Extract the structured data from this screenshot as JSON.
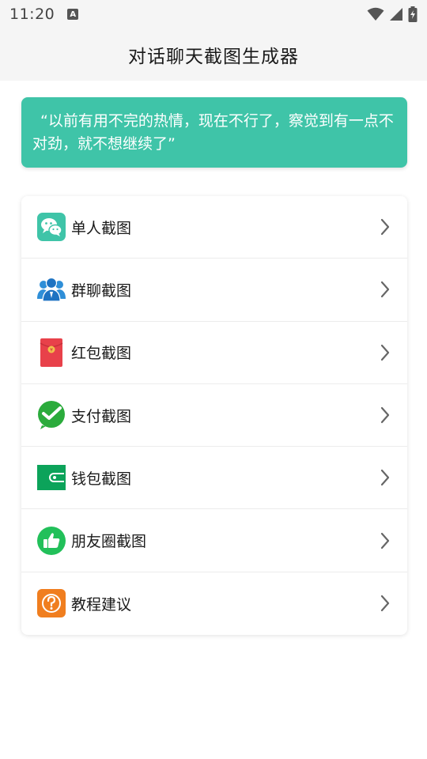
{
  "status_bar": {
    "time": "11:20",
    "notification_icon": "a-icon"
  },
  "header": {
    "title": "对话聊天截图生成器"
  },
  "quote": {
    "text": "“以前有用不完的热情，现在不行了，察觉到有一点不对劲，就不想继续了”"
  },
  "colors": {
    "accent": "#3fc4a8",
    "header_bg": "#f5f5f5",
    "red_packet": "#e8414a",
    "pay_green": "#2bab3c",
    "wallet_green": "#0ca35a",
    "moments_green": "#22c05a",
    "help_orange": "#f07e1f"
  },
  "menu": {
    "items": [
      {
        "label": "单人截图",
        "icon": "chat-bubbles-icon"
      },
      {
        "label": "群聊截图",
        "icon": "group-users-icon"
      },
      {
        "label": "红包截图",
        "icon": "red-packet-icon"
      },
      {
        "label": "支付截图",
        "icon": "pay-check-icon"
      },
      {
        "label": "钱包截图",
        "icon": "wallet-icon"
      },
      {
        "label": "朋友圈截图",
        "icon": "thumbs-up-icon"
      },
      {
        "label": "教程建议",
        "icon": "help-question-icon"
      }
    ]
  }
}
